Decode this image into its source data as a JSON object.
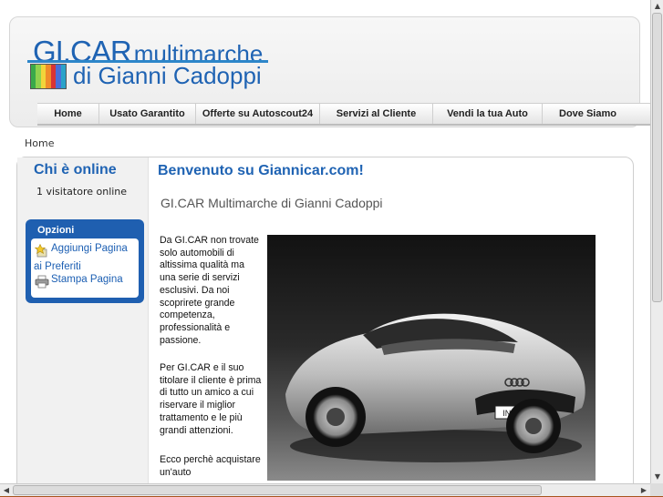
{
  "logo": {
    "line1_big": "GI.CAR",
    "line1_small": "multimarche",
    "line2": "di Gianni Cadoppi",
    "stripe_colors": [
      "#3aa94a",
      "#8fd14f",
      "#f2d43a",
      "#f08c2a",
      "#d93434",
      "#4a6ed9",
      "#2aa3c9"
    ]
  },
  "nav": {
    "items": [
      {
        "label": "Home"
      },
      {
        "label": "Usato Garantito"
      },
      {
        "label": "Offerte su Autoscout24"
      },
      {
        "label": "Servizi al Cliente"
      },
      {
        "label": "Vendi la tua Auto"
      },
      {
        "label": "Dove Siamo"
      }
    ]
  },
  "breadcrumb": "Home",
  "sidebar": {
    "who_title": "Chi è online",
    "who_count": "1 visitatore online",
    "options_title": "Opzioni",
    "add_fav_line1": "Aggiungi Pagina",
    "add_fav_line2": "ai Preferiti",
    "print_label": "Stampa Pagina"
  },
  "main": {
    "title": "Benvenuto su Giannicar.com!",
    "article_title": "GI.CAR Multimarche di Gianni Cadoppi",
    "paragraph1": "Da GI.CAR non trovate solo automobili di altissima qualità ma una serie di servizi esclusivi. Da noi scoprirete grande competenza, professionalità e passione.",
    "paragraph2": "Per GI.CAR e il suo titolare il cliente è prima di tutto un amico a cui riservare il miglior trattamento e le più grandi attenzioni.",
    "paragraph3": "Ecco perchè acquistare un'auto",
    "car_plate": "IN R 805"
  },
  "colors": {
    "accent_blue": "#1f63b3",
    "options_blue": "#1f5fb0",
    "window_bg": "#a8541d"
  }
}
